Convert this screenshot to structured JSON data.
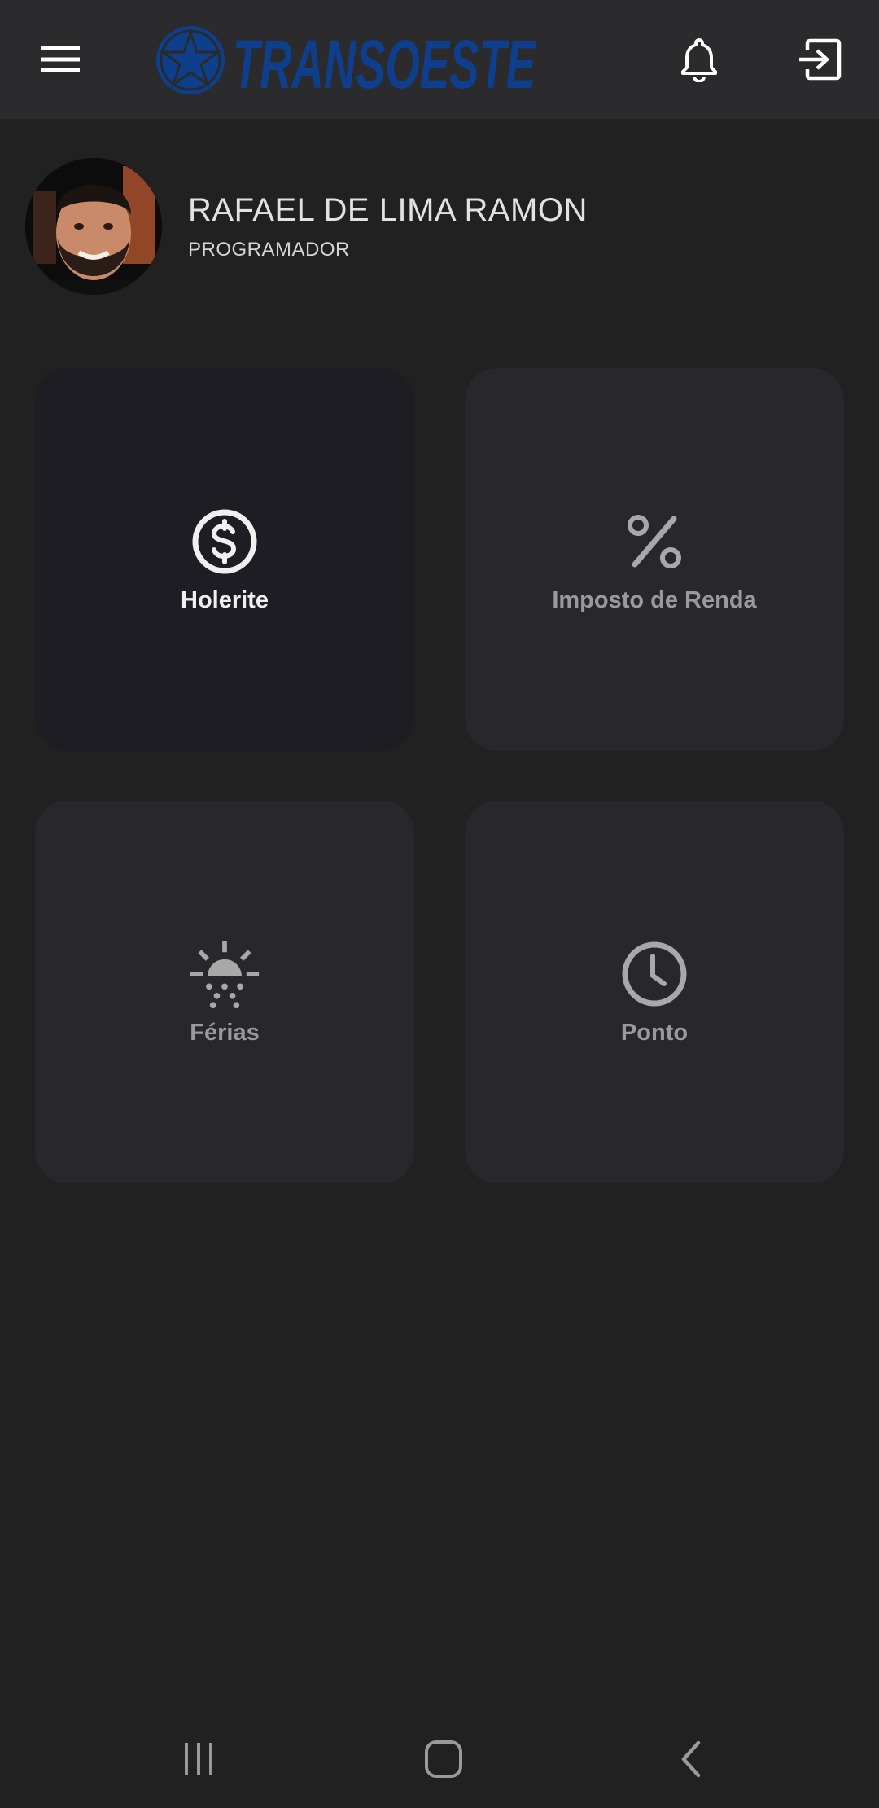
{
  "header": {
    "brand": "TRANSOESTE",
    "menu_icon": "menu-icon",
    "bell_icon": "bell-icon",
    "exit_icon": "exit-icon",
    "brand_color": "#0d3f8c"
  },
  "profile": {
    "name": "RAFAEL DE LIMA RAMON",
    "role": "PROGRAMADOR"
  },
  "cards": [
    {
      "label": "Holerite",
      "icon": "dollar-circle-icon",
      "selected": true
    },
    {
      "label": "Imposto de Renda",
      "icon": "percent-icon",
      "selected": false
    },
    {
      "label": "Férias",
      "icon": "sunrise-icon",
      "selected": false
    },
    {
      "label": "Ponto",
      "icon": "clock-icon",
      "selected": false
    }
  ],
  "system_nav": {
    "recents_icon": "recents-icon",
    "home_icon": "home-icon",
    "back_icon": "back-icon"
  },
  "colors": {
    "background": "#212121",
    "topbar": "#2b2b2d",
    "card": "#28272c",
    "card_selected": "#1e1d23",
    "label_active": "#f0f0f0",
    "label_inactive": "#9a9a9a"
  }
}
